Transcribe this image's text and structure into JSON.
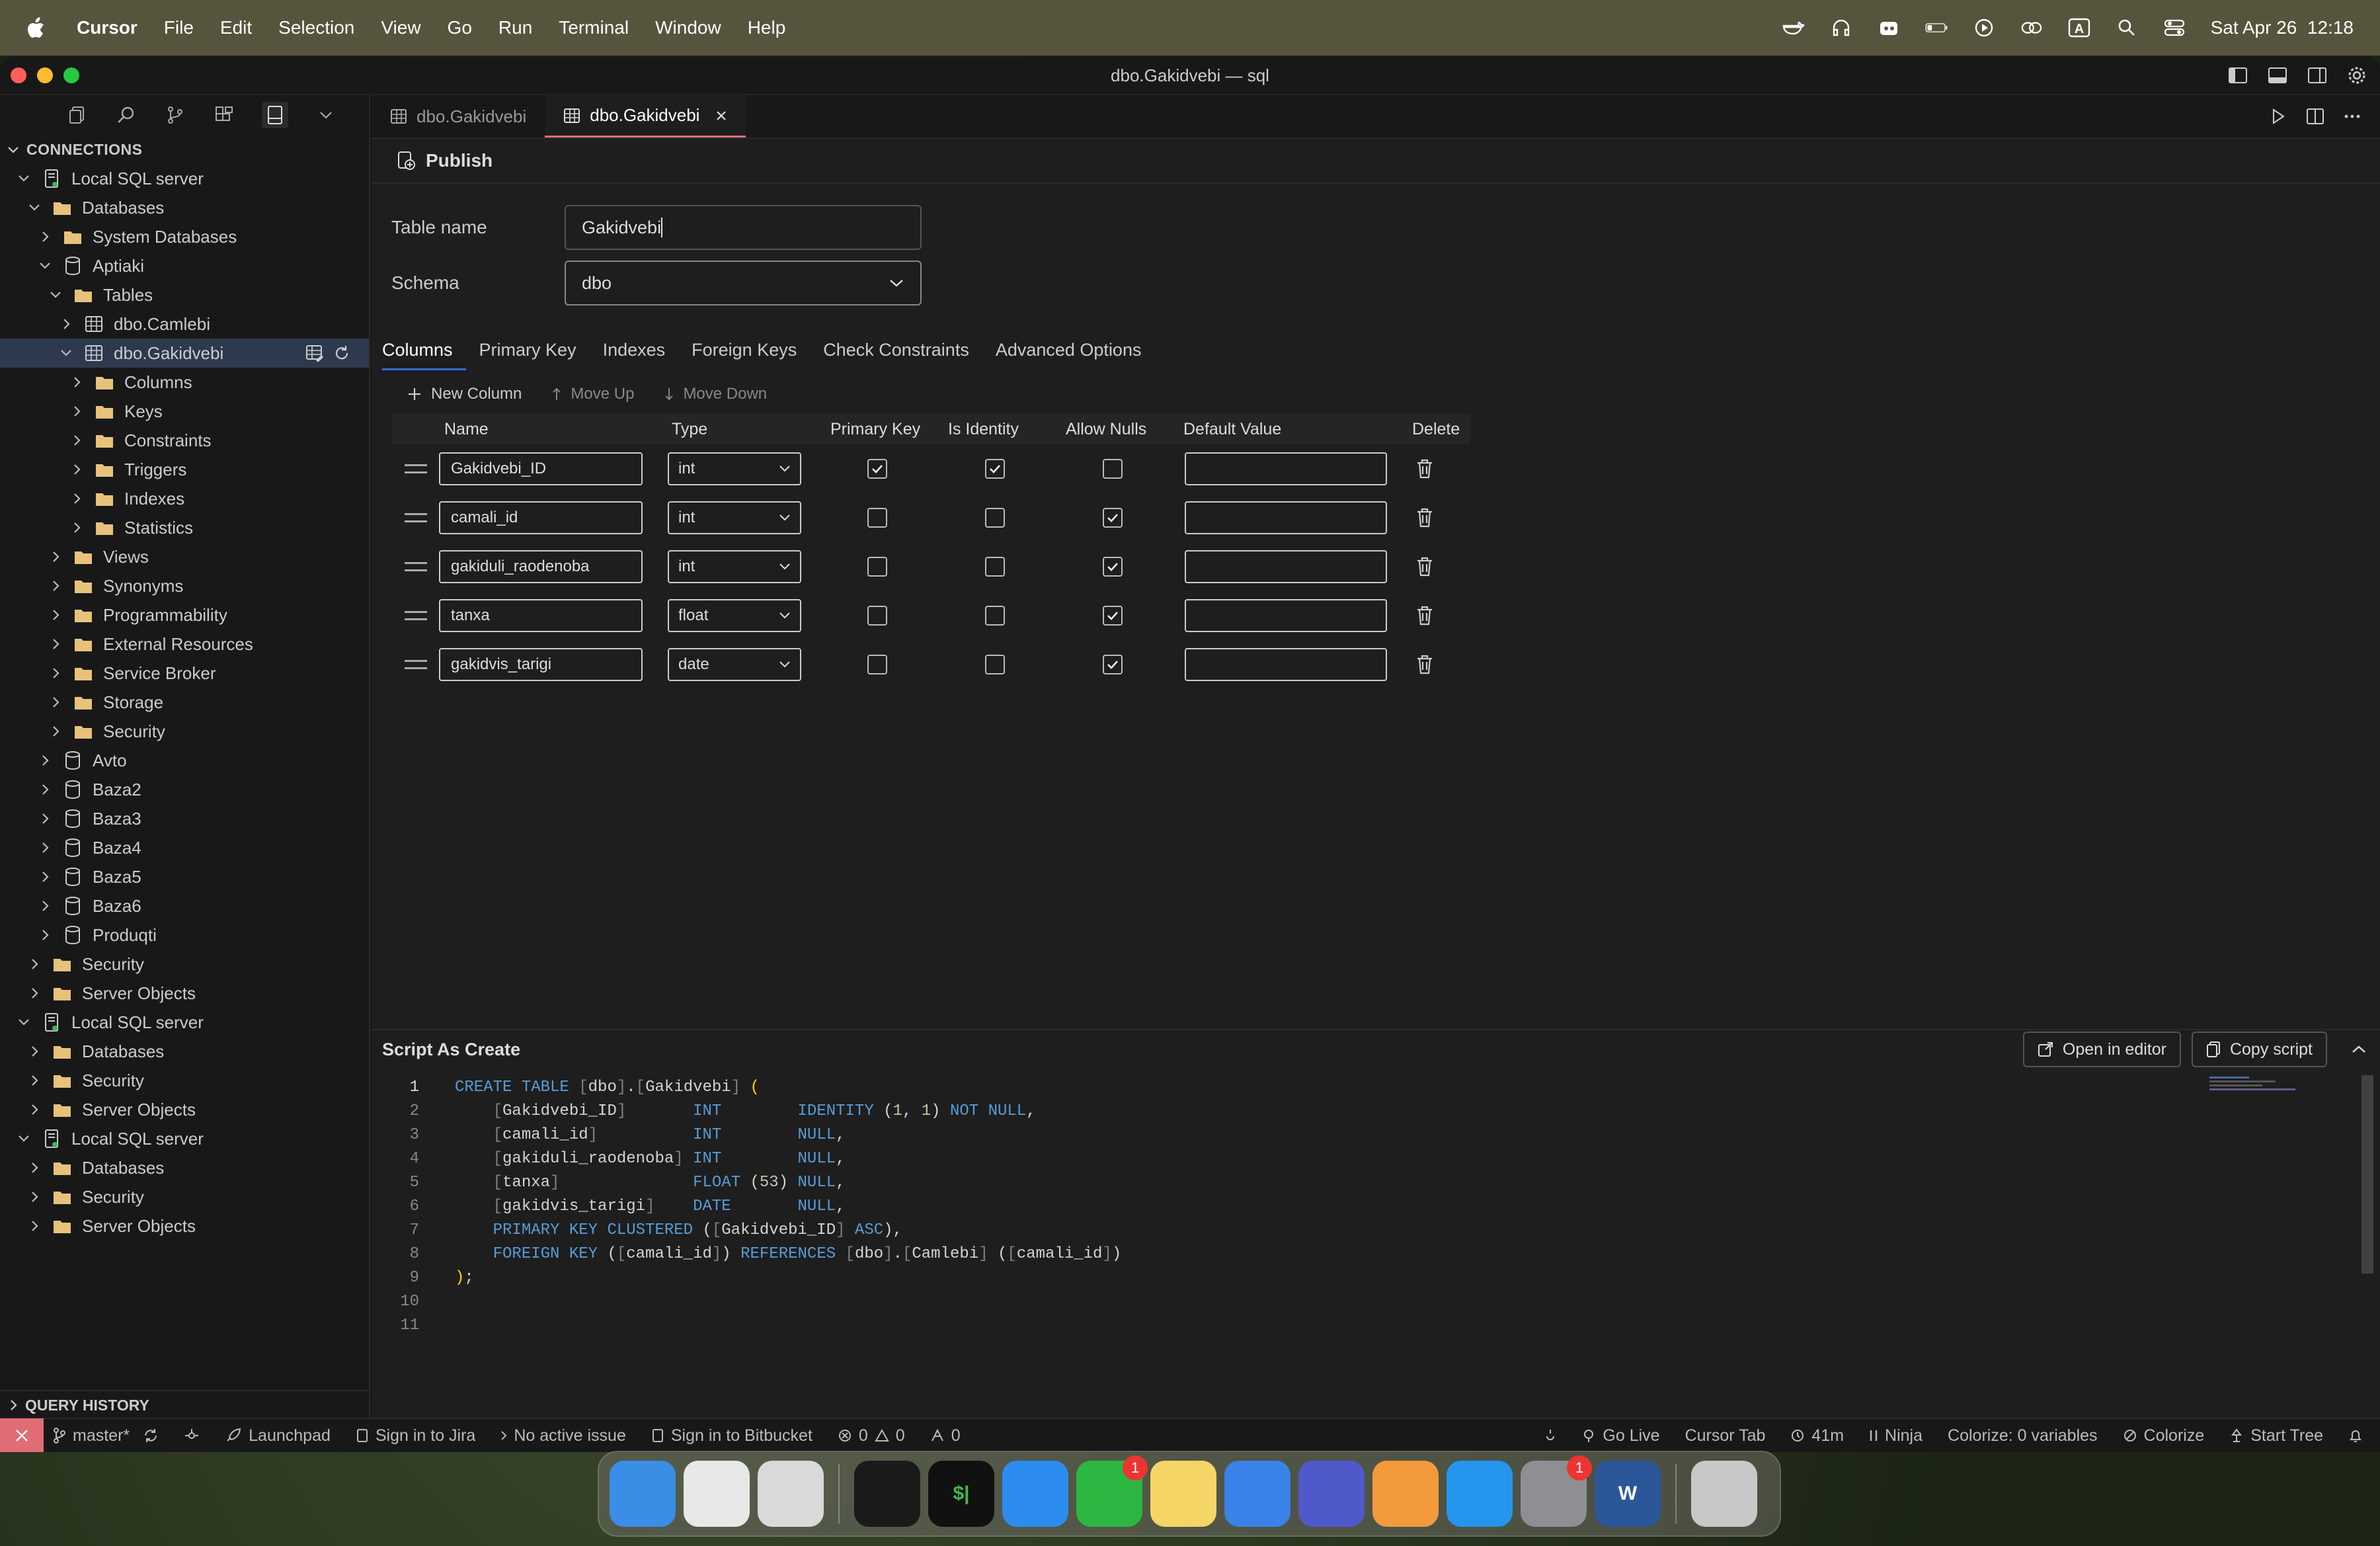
{
  "menubar": {
    "app": "Cursor",
    "items": [
      "File",
      "Edit",
      "Selection",
      "View",
      "Go",
      "Run",
      "Terminal",
      "Window",
      "Help"
    ],
    "datetime": "Sat Apr 26  12:18"
  },
  "window": {
    "title": "dbo.Gakidvebi — sql"
  },
  "sidebar": {
    "header": "CONNECTIONS",
    "tree": [
      {
        "label": "Local SQL server",
        "icon": "server-icon",
        "level": 0,
        "chev": "down"
      },
      {
        "label": "Databases",
        "icon": "folder-icon",
        "level": 1,
        "chev": "down"
      },
      {
        "label": "System Databases",
        "icon": "folder-icon",
        "level": 2,
        "chev": "right"
      },
      {
        "label": "Aptiaki",
        "icon": "database-icon",
        "level": 2,
        "chev": "down"
      },
      {
        "label": "Tables",
        "icon": "folder-icon",
        "level": 3,
        "chev": "down"
      },
      {
        "label": "dbo.Camlebi",
        "icon": "table-icon",
        "level": 4,
        "chev": "right"
      },
      {
        "label": "dbo.Gakidvebi",
        "icon": "table-icon",
        "level": 4,
        "chev": "down",
        "selected": true
      },
      {
        "label": "Columns",
        "icon": "folder-icon",
        "level": 5,
        "chev": "right"
      },
      {
        "label": "Keys",
        "icon": "folder-icon",
        "level": 5,
        "chev": "right"
      },
      {
        "label": "Constraints",
        "icon": "folder-icon",
        "level": 5,
        "chev": "right"
      },
      {
        "label": "Triggers",
        "icon": "folder-icon",
        "level": 5,
        "chev": "right"
      },
      {
        "label": "Indexes",
        "icon": "folder-icon",
        "level": 5,
        "chev": "right"
      },
      {
        "label": "Statistics",
        "icon": "folder-icon",
        "level": 5,
        "chev": "right"
      },
      {
        "label": "Views",
        "icon": "folder-icon",
        "level": 3,
        "chev": "right"
      },
      {
        "label": "Synonyms",
        "icon": "folder-icon",
        "level": 3,
        "chev": "right"
      },
      {
        "label": "Programmability",
        "icon": "folder-icon",
        "level": 3,
        "chev": "right"
      },
      {
        "label": "External Resources",
        "icon": "folder-icon",
        "level": 3,
        "chev": "right"
      },
      {
        "label": "Service Broker",
        "icon": "folder-icon",
        "level": 3,
        "chev": "right"
      },
      {
        "label": "Storage",
        "icon": "folder-icon",
        "level": 3,
        "chev": "right"
      },
      {
        "label": "Security",
        "icon": "folder-icon",
        "level": 3,
        "chev": "right"
      },
      {
        "label": "Avto",
        "icon": "database-icon",
        "level": 2,
        "chev": "right"
      },
      {
        "label": "Baza2",
        "icon": "database-icon",
        "level": 2,
        "chev": "right"
      },
      {
        "label": "Baza3",
        "icon": "database-icon",
        "level": 2,
        "chev": "right"
      },
      {
        "label": "Baza4",
        "icon": "database-icon",
        "level": 2,
        "chev": "right"
      },
      {
        "label": "Baza5",
        "icon": "database-icon",
        "level": 2,
        "chev": "right"
      },
      {
        "label": "Baza6",
        "icon": "database-icon",
        "level": 2,
        "chev": "right"
      },
      {
        "label": "Produqti",
        "icon": "database-icon",
        "level": 2,
        "chev": "right"
      },
      {
        "label": "Security",
        "icon": "folder-icon",
        "level": 1,
        "chev": "right"
      },
      {
        "label": "Server Objects",
        "icon": "folder-icon",
        "level": 1,
        "chev": "right"
      },
      {
        "label": "Local SQL server",
        "icon": "server-icon",
        "level": 0,
        "chev": "down"
      },
      {
        "label": "Databases",
        "icon": "folder-icon",
        "level": 1,
        "chev": "right"
      },
      {
        "label": "Security",
        "icon": "folder-icon",
        "level": 1,
        "chev": "right"
      },
      {
        "label": "Server Objects",
        "icon": "folder-icon",
        "level": 1,
        "chev": "right"
      },
      {
        "label": "Local SQL server",
        "icon": "server-icon",
        "level": 0,
        "chev": "down"
      },
      {
        "label": "Databases",
        "icon": "folder-icon",
        "level": 1,
        "chev": "right"
      },
      {
        "label": "Security",
        "icon": "folder-icon",
        "level": 1,
        "chev": "right"
      },
      {
        "label": "Server Objects",
        "icon": "folder-icon",
        "level": 1,
        "chev": "right"
      }
    ],
    "query_history": "QUERY HISTORY"
  },
  "tabs": [
    {
      "label": "dbo.Gakidvebi",
      "active": false
    },
    {
      "label": "dbo.Gakidvebi",
      "active": true
    }
  ],
  "designer": {
    "publish": "Publish",
    "table_name_label": "Table name",
    "table_name_value": "Gakidvebi",
    "schema_label": "Schema",
    "schema_value": "dbo",
    "tabs": [
      "Columns",
      "Primary Key",
      "Indexes",
      "Foreign Keys",
      "Check Constraints",
      "Advanced Options"
    ],
    "toolbar": {
      "new_column": "New Column",
      "move_up": "Move Up",
      "move_down": "Move Down"
    },
    "headers": {
      "name": "Name",
      "type": "Type",
      "pk": "Primary Key",
      "identity": "Is Identity",
      "nulls": "Allow Nulls",
      "default": "Default Value",
      "delete": "Delete"
    },
    "columns": [
      {
        "name": "Gakidvebi_ID",
        "type": "int",
        "pk": true,
        "identity": true,
        "nulls": false,
        "default": ""
      },
      {
        "name": "camali_id",
        "type": "int",
        "pk": false,
        "identity": false,
        "nulls": true,
        "default": ""
      },
      {
        "name": "gakiduli_raodenoba",
        "type": "int",
        "pk": false,
        "identity": false,
        "nulls": true,
        "default": ""
      },
      {
        "name": "tanxa",
        "type": "float",
        "pk": false,
        "identity": false,
        "nulls": true,
        "default": ""
      },
      {
        "name": "gakidvis_tarigi",
        "type": "date",
        "pk": false,
        "identity": false,
        "nulls": true,
        "default": ""
      }
    ]
  },
  "script": {
    "title": "Script As Create",
    "open_in_editor": "Open in editor",
    "copy_script": "Copy script",
    "lines": [
      [
        [
          "kw",
          "CREATE TABLE "
        ],
        [
          "gr",
          "["
        ],
        [
          "id",
          "dbo"
        ],
        [
          "gr",
          "]"
        ],
        [
          "id",
          "."
        ],
        [
          "gr",
          "["
        ],
        [
          "id",
          "Gakidvebi"
        ],
        [
          "gr",
          "]"
        ],
        [
          "yl",
          " ("
        ]
      ],
      [
        [
          "id",
          "    "
        ],
        [
          "gr",
          "["
        ],
        [
          "id",
          "Gakidvebi_ID"
        ],
        [
          "gr",
          "]"
        ],
        [
          "id",
          "       "
        ],
        [
          "ty",
          "INT"
        ],
        [
          "id",
          "        "
        ],
        [
          "kw",
          "IDENTITY "
        ],
        [
          "id",
          "("
        ],
        [
          "nm",
          "1"
        ],
        [
          "id",
          ", "
        ],
        [
          "nm",
          "1"
        ],
        [
          "id",
          ") "
        ],
        [
          "kw",
          "NOT NULL"
        ],
        [
          "id",
          ","
        ]
      ],
      [
        [
          "id",
          "    "
        ],
        [
          "gr",
          "["
        ],
        [
          "id",
          "camali_id"
        ],
        [
          "gr",
          "]"
        ],
        [
          "id",
          "          "
        ],
        [
          "ty",
          "INT"
        ],
        [
          "id",
          "        "
        ],
        [
          "kw",
          "NULL"
        ],
        [
          "id",
          ","
        ]
      ],
      [
        [
          "id",
          "    "
        ],
        [
          "gr",
          "["
        ],
        [
          "id",
          "gakiduli_raodenoba"
        ],
        [
          "gr",
          "]"
        ],
        [
          "id",
          " "
        ],
        [
          "ty",
          "INT"
        ],
        [
          "id",
          "        "
        ],
        [
          "kw",
          "NULL"
        ],
        [
          "id",
          ","
        ]
      ],
      [
        [
          "id",
          "    "
        ],
        [
          "gr",
          "["
        ],
        [
          "id",
          "tanxa"
        ],
        [
          "gr",
          "]"
        ],
        [
          "id",
          "              "
        ],
        [
          "ty",
          "FLOAT"
        ],
        [
          "id",
          " ("
        ],
        [
          "nm",
          "53"
        ],
        [
          "id",
          ") "
        ],
        [
          "kw",
          "NULL"
        ],
        [
          "id",
          ","
        ]
      ],
      [
        [
          "id",
          "    "
        ],
        [
          "gr",
          "["
        ],
        [
          "id",
          "gakidvis_tarigi"
        ],
        [
          "gr",
          "]"
        ],
        [
          "id",
          "    "
        ],
        [
          "ty",
          "DATE"
        ],
        [
          "id",
          "       "
        ],
        [
          "kw",
          "NULL"
        ],
        [
          "id",
          ","
        ]
      ],
      [
        [
          "id",
          "    "
        ],
        [
          "kw",
          "PRIMARY KEY CLUSTERED "
        ],
        [
          "id",
          "("
        ],
        [
          "gr",
          "["
        ],
        [
          "id",
          "Gakidvebi_ID"
        ],
        [
          "gr",
          "]"
        ],
        [
          "kw",
          " ASC"
        ],
        [
          "id",
          "),"
        ]
      ],
      [
        [
          "id",
          "    "
        ],
        [
          "kw",
          "FOREIGN KEY "
        ],
        [
          "id",
          "("
        ],
        [
          "gr",
          "["
        ],
        [
          "id",
          "camali_id"
        ],
        [
          "gr",
          "]"
        ],
        [
          "id",
          ") "
        ],
        [
          "kw",
          "REFERENCES "
        ],
        [
          "gr",
          "["
        ],
        [
          "id",
          "dbo"
        ],
        [
          "gr",
          "]"
        ],
        [
          "id",
          "."
        ],
        [
          "gr",
          "["
        ],
        [
          "id",
          "Camlebi"
        ],
        [
          "gr",
          "]"
        ],
        [
          "id",
          " ("
        ],
        [
          "gr",
          "["
        ],
        [
          "id",
          "camali_id"
        ],
        [
          "gr",
          "]"
        ],
        [
          "id",
          ")"
        ]
      ],
      [
        [
          "yl",
          ")"
        ],
        [
          "id",
          ";"
        ]
      ],
      [],
      []
    ]
  },
  "status": {
    "branch": "master*",
    "launchpad": "Launchpad",
    "jira": "Sign in to Jira",
    "issue": "No active issue",
    "bitbucket": "Sign in to Bitbucket",
    "errors": "0",
    "warnings": "0",
    "ports": "0",
    "go_live": "Go Live",
    "cursor_tab": "Cursor Tab",
    "time": "41m",
    "ninja": "Ninja",
    "colorize_vars": "Colorize: 0 variables",
    "colorize": "Colorize",
    "start_tree": "Start Tree"
  },
  "dock": {
    "apps": [
      {
        "name": "finder",
        "label": "",
        "color": "#3a8ee6"
      },
      {
        "name": "chrome",
        "label": "",
        "color": "#e8e8e8"
      },
      {
        "name": "launchpad",
        "label": "",
        "color": "#d9d9d9"
      },
      {
        "name": "cursor",
        "label": "",
        "color": "#1a1a1a"
      },
      {
        "name": "terminal",
        "label": "$|",
        "color": "#111"
      },
      {
        "name": "app-store",
        "label": "",
        "color": "#2d8cf0"
      },
      {
        "name": "whatsapp",
        "label": "",
        "color": "#2bb741",
        "badge": "1"
      },
      {
        "name": "notes",
        "label": "",
        "color": "#f5d566"
      },
      {
        "name": "xcode",
        "label": "",
        "color": "#3b82e8"
      },
      {
        "name": "teams",
        "label": "",
        "color": "#5059c9"
      },
      {
        "name": "vpn",
        "label": "",
        "color": "#f39a3c"
      },
      {
        "name": "docker",
        "label": "",
        "color": "#2496ed"
      },
      {
        "name": "system-settings",
        "label": "",
        "color": "#8e8e93",
        "badge": "1"
      },
      {
        "name": "word",
        "label": "W",
        "color": "#2b579a"
      },
      {
        "name": "trash",
        "label": "",
        "color": "#c8c8c8"
      }
    ]
  },
  "colors": {
    "accent": "#2d6fd6",
    "tab_active_underline": "#e06c75",
    "remote_indicator": "#e06c75",
    "folder": "#e8c27a"
  }
}
